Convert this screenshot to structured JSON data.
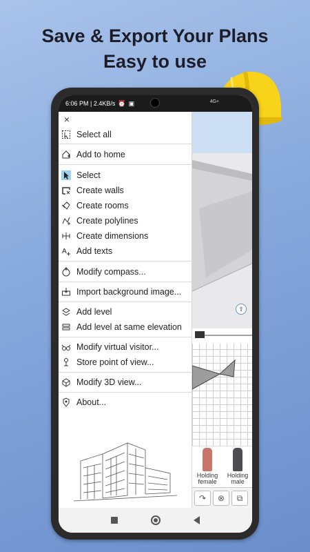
{
  "promo": {
    "line1": "Save & Export Your Plans",
    "line2": "Easy to use"
  },
  "statusbar": {
    "time_speed": "6:06 PM | 2.4KB/s",
    "right_icons": "4G+"
  },
  "menu": {
    "close": "×",
    "items": [
      {
        "label": "Select all",
        "icon": "select-all-icon"
      },
      {
        "label": "Add to home",
        "icon": "add-to-home-icon"
      },
      {
        "label": "Select",
        "icon": "cursor-icon"
      },
      {
        "label": "Create walls",
        "icon": "walls-icon"
      },
      {
        "label": "Create rooms",
        "icon": "rooms-icon"
      },
      {
        "label": "Create polylines",
        "icon": "polyline-icon"
      },
      {
        "label": "Create dimensions",
        "icon": "dimension-icon"
      },
      {
        "label": "Add texts",
        "icon": "text-icon"
      },
      {
        "label": "Modify compass...",
        "icon": "compass-icon"
      },
      {
        "label": "Import background image...",
        "icon": "background-image-icon"
      },
      {
        "label": "Add level",
        "icon": "level-icon"
      },
      {
        "label": "Add level at same elevation",
        "icon": "level-same-icon"
      },
      {
        "label": "Modify virtual visitor...",
        "icon": "visitor-icon"
      },
      {
        "label": "Store point of view...",
        "icon": "point-of-view-icon"
      },
      {
        "label": "Modify 3D view...",
        "icon": "3d-view-icon"
      },
      {
        "label": "About...",
        "icon": "about-icon"
      }
    ]
  },
  "furniture": {
    "item1": "Holding female",
    "item2": "Holding male"
  },
  "colors": {
    "accent_select": "#9fd0f0",
    "helmet": "#f7d31a"
  }
}
